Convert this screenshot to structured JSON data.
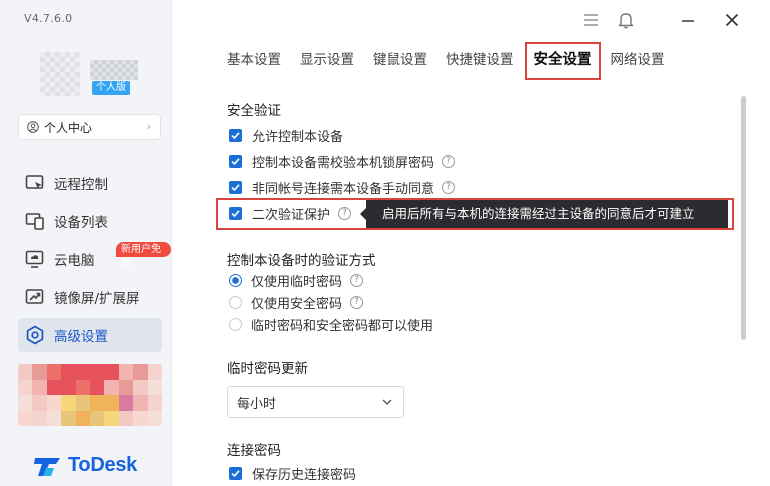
{
  "app": {
    "version": "V4.7.6.0",
    "logo_text": "ToDesk"
  },
  "account": {
    "plan_badge": "个人版",
    "personal_center": "个人中心"
  },
  "sidebar": {
    "items": [
      {
        "label": "远程控制",
        "icon": "remote-control-icon"
      },
      {
        "label": "设备列表",
        "icon": "device-list-icon"
      },
      {
        "label": "云电脑",
        "icon": "cloud-pc-icon",
        "badge": "新用户免费"
      },
      {
        "label": "镜像屏/扩展屏",
        "icon": "mirror-screen-icon"
      },
      {
        "label": "高级设置",
        "icon": "advanced-settings-icon",
        "active": true
      }
    ]
  },
  "tabs": [
    {
      "label": "基本设置"
    },
    {
      "label": "显示设置"
    },
    {
      "label": "键鼠设置"
    },
    {
      "label": "快捷键设置"
    },
    {
      "label": "安全设置",
      "active": true
    },
    {
      "label": "网络设置"
    }
  ],
  "security": {
    "title": "安全验证",
    "options": [
      {
        "label": "允许控制本设备",
        "checked": true,
        "help": false
      },
      {
        "label": "控制本设备需校验本机锁屏密码",
        "checked": true,
        "help": true
      },
      {
        "label": "非同帐号连接需本设备手动同意",
        "checked": true,
        "help": true
      },
      {
        "label": "二次验证保护",
        "checked": true,
        "help": true
      }
    ],
    "tooltip": "启用后所有与本机的连接需经过主设备的同意后才可建立"
  },
  "verify_method": {
    "title": "控制本设备时的验证方式",
    "options": [
      {
        "label": "仅使用临时密码",
        "selected": true,
        "help": true
      },
      {
        "label": "仅使用安全密码",
        "selected": false,
        "help": true
      },
      {
        "label": "临时密码和安全密码都可以使用",
        "selected": false,
        "help": false
      }
    ]
  },
  "temp_password": {
    "title": "临时密码更新",
    "value": "每小时"
  },
  "connection_password": {
    "title": "连接密码",
    "save_history": "保存历史连接密码",
    "save_history_checked": true
  },
  "colors": {
    "accent": "#1c6fd6",
    "highlight": "#d9453b",
    "badge_red": "#f04c3e",
    "plan_blue": "#35a4f3",
    "logo_blue": "#1563e0"
  }
}
